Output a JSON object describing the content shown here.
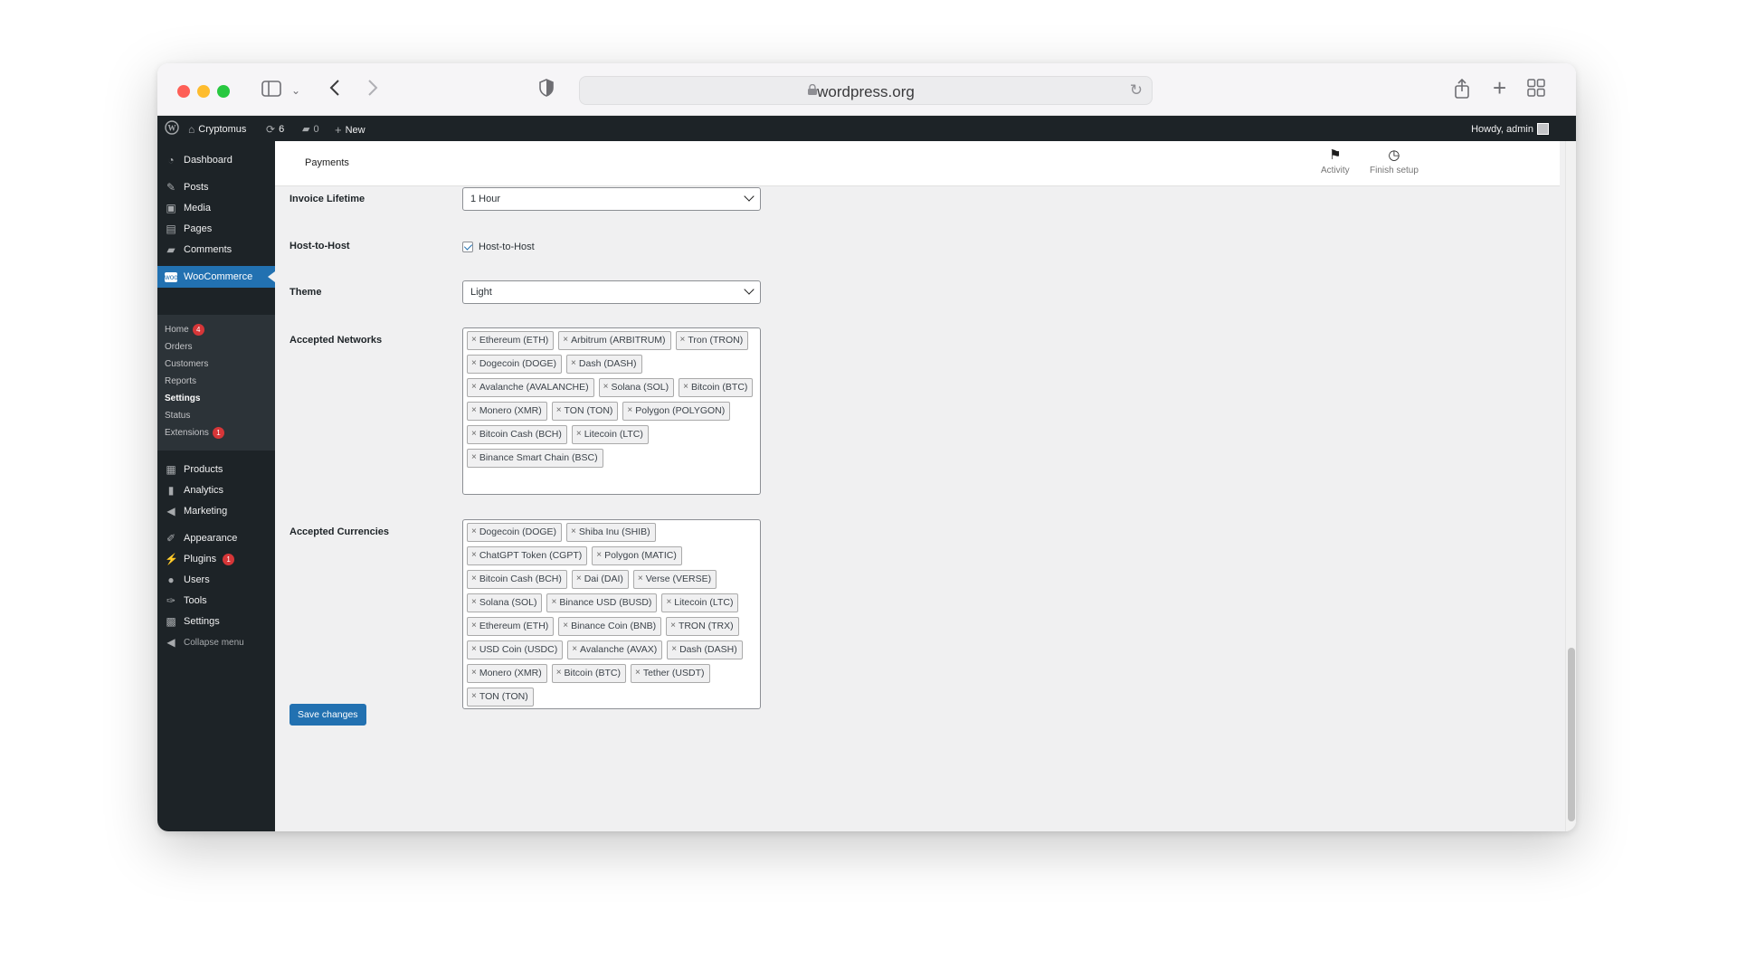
{
  "browser": {
    "url": "wordpress.org"
  },
  "adminbar": {
    "site_name": "Cryptomus",
    "updates_count": "6",
    "comments_count": "0",
    "new_label": "New",
    "howdy": "Howdy, admin"
  },
  "sidebar": {
    "dashboard": "Dashboard",
    "posts": "Posts",
    "media": "Media",
    "pages": "Pages",
    "comments": "Comments",
    "woocommerce": "WooCommerce",
    "sub": {
      "home": "Home",
      "home_badge": "4",
      "orders": "Orders",
      "customers": "Customers",
      "reports": "Reports",
      "settings": "Settings",
      "status": "Status",
      "extensions": "Extensions",
      "extensions_badge": "1"
    },
    "products": "Products",
    "analytics": "Analytics",
    "marketing": "Marketing",
    "appearance": "Appearance",
    "plugins": "Plugins",
    "plugins_badge": "1",
    "users": "Users",
    "tools": "Tools",
    "settings": "Settings",
    "collapse": "Collapse menu"
  },
  "header": {
    "title": "Payments",
    "activity": "Activity",
    "finish_setup": "Finish setup"
  },
  "form": {
    "invoice_lifetime_label": "Invoice Lifetime",
    "invoice_lifetime_value": "1 Hour",
    "host_label": "Host-to-Host",
    "host_checkbox_label": "Host-to-Host",
    "theme_label": "Theme",
    "theme_value": "Light",
    "networks_label": "Accepted Networks",
    "networks": [
      "Ethereum (ETH)",
      "Arbitrum (ARBITRUM)",
      "Tron (TRON)",
      "Dogecoin (DOGE)",
      "Dash (DASH)",
      "Avalanche (AVALANCHE)",
      "Solana (SOL)",
      "Bitcoin (BTC)",
      "Monero (XMR)",
      "TON (TON)",
      "Polygon (POLYGON)",
      "Bitcoin Cash (BCH)",
      "Litecoin (LTC)",
      "Binance Smart Chain (BSC)"
    ],
    "currencies_label": "Accepted Currencies",
    "currencies": [
      "Dogecoin (DOGE)",
      "Shiba Inu (SHIB)",
      "ChatGPT Token (CGPT)",
      "Polygon (MATIC)",
      "Bitcoin Cash (BCH)",
      "Dai (DAI)",
      "Verse (VERSE)",
      "Solana (SOL)",
      "Binance USD (BUSD)",
      "Litecoin (LTC)",
      "Ethereum (ETH)",
      "Binance Coin (BNB)",
      "TRON (TRX)",
      "USD Coin (USDC)",
      "Avalanche (AVAX)",
      "Dash (DASH)",
      "Monero (XMR)",
      "Bitcoin (BTC)",
      "Tether (USDT)",
      "TON (TON)"
    ],
    "save_label": "Save changes"
  },
  "colors": {
    "wp_dark": "#1d2327",
    "wp_blue": "#2271b1",
    "badge_red": "#d63638"
  }
}
